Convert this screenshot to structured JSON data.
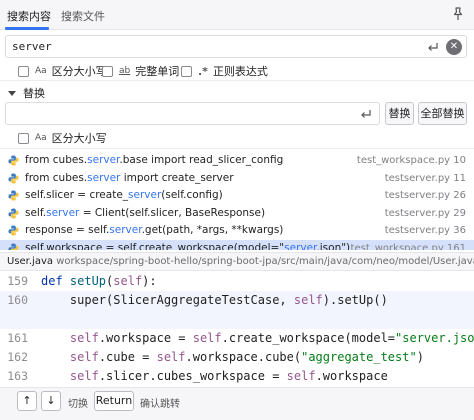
{
  "tabs": [
    {
      "label": "搜索内容"
    },
    {
      "label": "搜索文件"
    }
  ],
  "search": {
    "value": "server"
  },
  "search_options": [
    {
      "icon": "Aa",
      "label": "区分大小写"
    },
    {
      "icon": "ab",
      "label": "完整单词"
    },
    {
      "icon": ".*",
      "label": "正则表达式"
    }
  ],
  "replace": {
    "header": "替换",
    "value": "",
    "replace_button": "替换",
    "replace_all_button": "全部替换",
    "option": {
      "icon": "Aa",
      "label": "区分大小写"
    }
  },
  "results": [
    {
      "before": "from cubes.",
      "match": "server",
      "after": ".base import read_slicer_config",
      "file": "test_workspace.py 10"
    },
    {
      "before": "from cubes.",
      "match": "server",
      "after": " import create_server",
      "file": "testserver.py 11"
    },
    {
      "before": "self.slicer = create_",
      "match": "server",
      "after": "(self.config)",
      "file": "testserver.py 26"
    },
    {
      "before": "self.",
      "match": "server",
      "after": " = Client(self.slicer, BaseResponse)",
      "file": "testserver.py 29"
    },
    {
      "before": "response = self.",
      "match": "server",
      "after": ".get(path, *args, **kwargs)",
      "file": "testserver.py 36"
    },
    {
      "before": "self.workspace = self.create_workspace(model=\"",
      "match": "server",
      "after": ".json\")",
      "file": "test_workspace.py 161"
    }
  ],
  "path_bar": {
    "file": "User.java",
    "path": "workspace/spring-boot-hello/spring-boot-jpa/src/main/java/com/neo/model/User.java"
  },
  "editor_lines": [
    {
      "number": "159",
      "segments": [
        {
          "t": "def ",
          "c": "kw"
        },
        {
          "t": "setUp",
          "c": "fn"
        },
        {
          "t": "(",
          "c": ""
        },
        {
          "t": "self",
          "c": "sf"
        },
        {
          "t": "):",
          "c": ""
        }
      ]
    },
    {
      "number": "160",
      "segments": [
        {
          "t": "    super(SlicerAggregateTestCase, ",
          "c": ""
        },
        {
          "t": "self",
          "c": "sf"
        },
        {
          "t": ").setUp()",
          "c": ""
        }
      ]
    },
    {
      "number": "",
      "segments": []
    },
    {
      "number": "161",
      "segments": [
        {
          "t": "    ",
          "c": ""
        },
        {
          "t": "self",
          "c": "sf"
        },
        {
          "t": ".workspace = ",
          "c": ""
        },
        {
          "t": "self",
          "c": "sf"
        },
        {
          "t": ".create_workspace(model=",
          "c": ""
        },
        {
          "t": "\"server.json\"",
          "c": "str"
        },
        {
          "t": ")",
          "c": ""
        }
      ]
    },
    {
      "number": "162",
      "segments": [
        {
          "t": "    ",
          "c": ""
        },
        {
          "t": "self",
          "c": "sf"
        },
        {
          "t": ".cube = ",
          "c": ""
        },
        {
          "t": "self",
          "c": "sf"
        },
        {
          "t": ".workspace.cube(",
          "c": ""
        },
        {
          "t": "\"aggregate_test\"",
          "c": "str"
        },
        {
          "t": ")",
          "c": ""
        }
      ]
    },
    {
      "number": "163",
      "segments": [
        {
          "t": "    ",
          "c": ""
        },
        {
          "t": "self",
          "c": "sf"
        },
        {
          "t": ".slicer.cubes_workspace = ",
          "c": ""
        },
        {
          "t": "self",
          "c": "sf"
        },
        {
          "t": ".workspace",
          "c": ""
        }
      ]
    }
  ],
  "footer": {
    "up_key": "↑",
    "down_key": "↓",
    "switch_label": "切换",
    "return_key": "Return",
    "confirm_label": "确认跳转"
  }
}
